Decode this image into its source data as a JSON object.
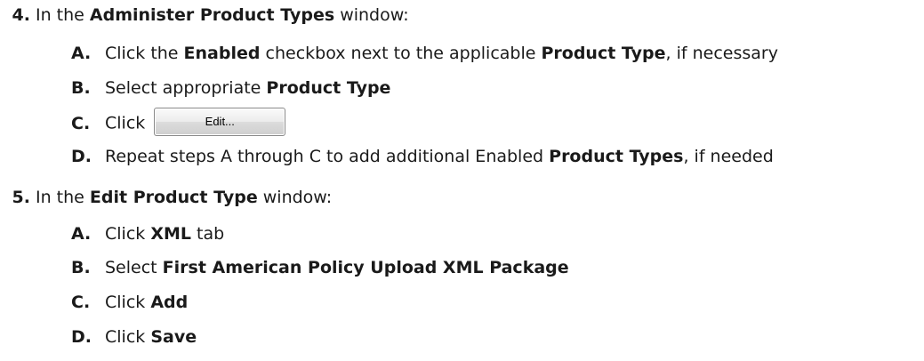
{
  "step4": {
    "number": "4.",
    "text_prefix": "In the ",
    "window": "Administer Product Types",
    "text_suffix": " window:",
    "substeps": {
      "a": {
        "letter": "A.",
        "t1": "Click the ",
        "b1": "Enabled",
        "t2": " checkbox next to the applicable ",
        "b2": "Product Type",
        "t3": ", if necessary"
      },
      "b": {
        "letter": "B.",
        "t1": "Select appropriate ",
        "b1": "Product Type"
      },
      "c": {
        "letter": "C.",
        "t1": "Click",
        "button_label": "Edit..."
      },
      "d": {
        "letter": "D.",
        "t1": "Repeat steps A through C to add additional Enabled ",
        "b1": "Product Types",
        "t2": ", if needed"
      }
    }
  },
  "step5": {
    "number": "5.",
    "text_prefix": "In the ",
    "window": "Edit Product Type",
    "text_suffix": " window:",
    "substeps": {
      "a": {
        "letter": "A.",
        "t1": "Click ",
        "b1": "XML",
        "t2": " tab"
      },
      "b": {
        "letter": "B.",
        "t1": "Select ",
        "b1": "First American Policy Upload XML Package"
      },
      "c": {
        "letter": "C.",
        "t1": "Click ",
        "b1": "Add"
      },
      "d": {
        "letter": "D.",
        "t1": "Click ",
        "b1": "Save"
      }
    }
  }
}
